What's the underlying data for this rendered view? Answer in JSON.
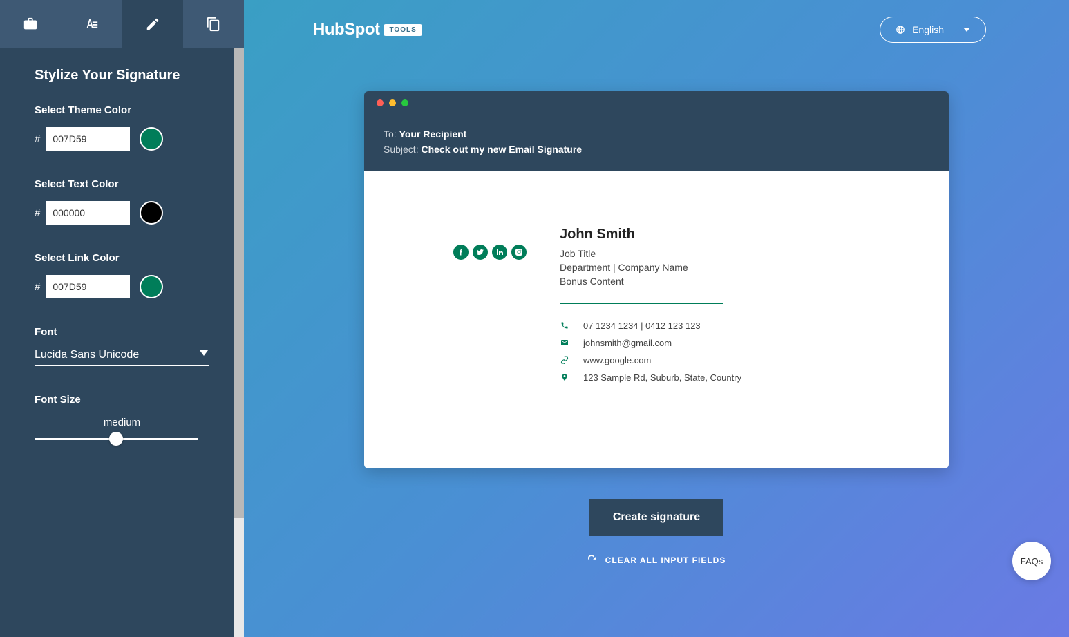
{
  "header": {
    "logo_text": "HubSpot",
    "logo_badge": "TOOLS",
    "language": "English"
  },
  "sidebar": {
    "title": "Stylize Your Signature",
    "theme_color": {
      "label": "Select Theme Color",
      "value": "007D59",
      "hex": "#007D59"
    },
    "text_color": {
      "label": "Select Text Color",
      "value": "000000",
      "hex": "#000000"
    },
    "link_color": {
      "label": "Select Link Color",
      "value": "007D59",
      "hex": "#007D59"
    },
    "font": {
      "label": "Font",
      "value": "Lucida Sans Unicode"
    },
    "font_size": {
      "label": "Font Size",
      "current": "medium"
    }
  },
  "preview": {
    "to_label": "To:",
    "to_value": "Your Recipient",
    "subject_label": "Subject:",
    "subject_value": "Check out my new Email Signature",
    "signature": {
      "name": "John Smith",
      "job_title": "Job Title",
      "department_company": "Department | Company Name",
      "bonus": "Bonus Content",
      "phone": "07 1234 1234 | 0412 123 123",
      "email": "johnsmith@gmail.com",
      "website": "www.google.com",
      "address": "123 Sample Rd, Suburb, State, Country"
    }
  },
  "actions": {
    "create": "Create signature",
    "clear": "CLEAR ALL INPUT FIELDS"
  },
  "faqs_label": "FAQs"
}
